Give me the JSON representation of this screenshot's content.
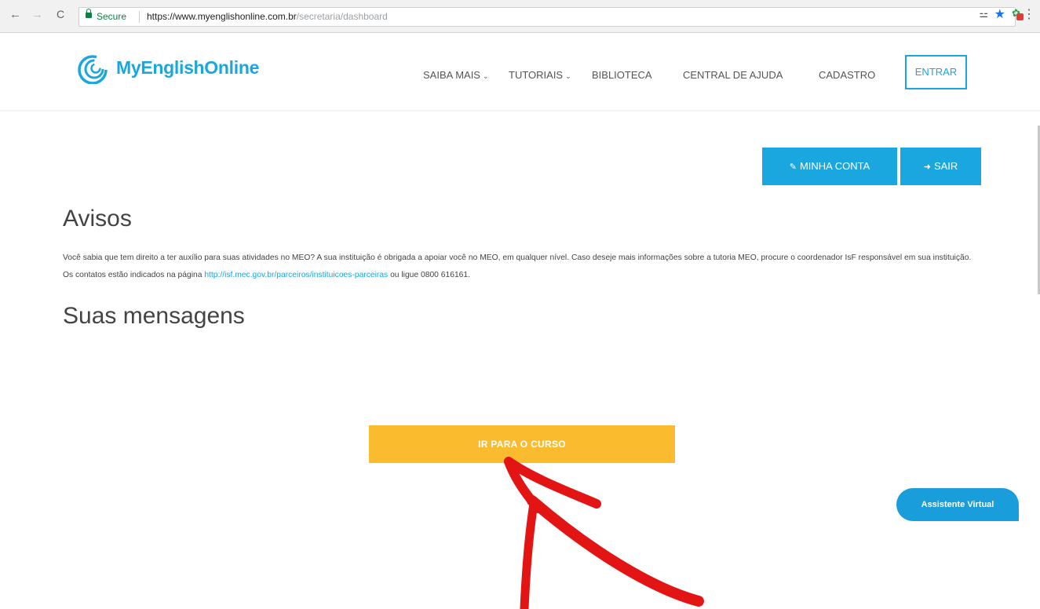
{
  "browser": {
    "secure_label": "Secure",
    "url_host": "https://www.myenglishonline.com.br",
    "url_path": "/secretaria/dashboard",
    "icons": [
      "back-arrow-icon",
      "forward-arrow-icon",
      "reload-icon",
      "lock-icon",
      "key-icon",
      "star-icon",
      "extension-icon",
      "menu-dots-icon"
    ]
  },
  "header": {
    "logo_text": "MyEnglishOnline",
    "nav": [
      {
        "label": "SAIBA MAIS",
        "dropdown": true
      },
      {
        "label": "TUTORIAIS",
        "dropdown": true
      },
      {
        "label": "BIBLIOTECA",
        "dropdown": false
      },
      {
        "label": "CENTRAL DE AJUDA",
        "dropdown": false
      },
      {
        "label": "CADASTRO",
        "dropdown": false
      }
    ],
    "login_label": "ENTRAR"
  },
  "account": {
    "my_account_label": "MINHA CONTA",
    "logout_label": "SAIR"
  },
  "notices": {
    "title": "Avisos",
    "text_before_link": "Você sabia que tem direito a ter auxílio para suas atividades no MEO? A sua instituição é obrigada a apoiar você no MEO, em qualquer nível. Caso deseje mais informações sobre a tutoria MEO, procure o coordenador IsF responsável em sua instituição. Os contatos estão indicados na página ",
    "link_text": "http://isf.mec.gov.br/parceiros/instituicoes-parceiras",
    "text_after_link": " ou ligue 0800 616161."
  },
  "messages": {
    "title": "Suas mensagens"
  },
  "course_button_label": "IR PARA O CURSO",
  "assistant_label": "Assistente Virtual",
  "colors": {
    "brand_blue": "#1aa6de",
    "course_yellow": "#fbbb2e",
    "annotation_red": "#e31414"
  }
}
